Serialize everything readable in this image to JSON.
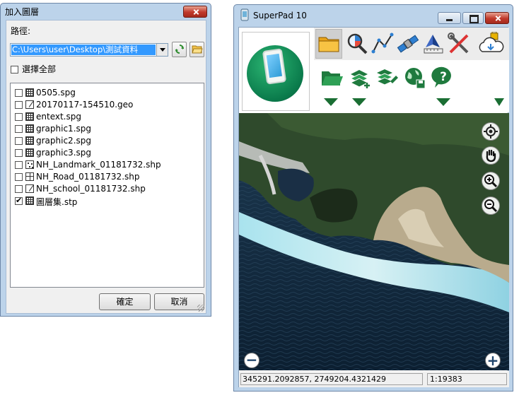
{
  "add_layer_dialog": {
    "title": "加入圖層",
    "path_label": "路徑:",
    "path_value": "C:\\Users\\user\\Desktop\\測試資料",
    "select_all_label": "選擇全部",
    "files": [
      {
        "name": "0505.spg",
        "icon": "grid-icon",
        "checked": false
      },
      {
        "name": "20170117-154510.geo",
        "icon": "geo-icon",
        "checked": false
      },
      {
        "name": "entext.spg",
        "icon": "grid-icon",
        "checked": false
      },
      {
        "name": "graphic1.spg",
        "icon": "grid-icon",
        "checked": false
      },
      {
        "name": "graphic2.spg",
        "icon": "grid-icon",
        "checked": false
      },
      {
        "name": "graphic3.spg",
        "icon": "grid-icon",
        "checked": false
      },
      {
        "name": "NH_Landmark_01181732.shp",
        "icon": "point-layer-icon",
        "checked": false
      },
      {
        "name": "NH_Road_01181732.shp",
        "icon": "line-layer-icon",
        "checked": false
      },
      {
        "name": "NH_school_01181732.shp",
        "icon": "geo-icon",
        "checked": false
      },
      {
        "name": "圖層集.stp",
        "icon": "grid-icon",
        "checked": true
      }
    ],
    "ok_label": "確定",
    "cancel_label": "取消"
  },
  "superpad": {
    "title": "SuperPad 10",
    "coordinates": "345291.2092857, 2749204.4321429",
    "scale": "1:19383",
    "top_tools": [
      "folder-icon",
      "search-icon",
      "draw-icon",
      "satellite-icon",
      "survey-icon",
      "tools-icon",
      "cloud-icon"
    ],
    "layer_tools": [
      "open-layer-icon",
      "add-layer-icon",
      "edit-layer-icon",
      "globe-save-icon",
      "help-icon"
    ]
  }
}
